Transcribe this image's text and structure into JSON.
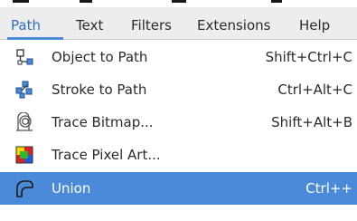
{
  "menubar": {
    "items": [
      {
        "label": "Path"
      },
      {
        "label": "Text"
      },
      {
        "label": "Filters"
      },
      {
        "label": "Extensions"
      },
      {
        "label": "Help"
      }
    ],
    "active": "Path"
  },
  "menu": {
    "items": [
      {
        "label": "Object to Path",
        "shortcut": "Shift+Ctrl+C",
        "icon": "object-to-path-icon"
      },
      {
        "label": "Stroke to Path",
        "shortcut": "Ctrl+Alt+C",
        "icon": "stroke-to-path-icon"
      },
      {
        "label": "Trace Bitmap...",
        "shortcut": "Shift+Alt+B",
        "icon": "trace-bitmap-icon"
      },
      {
        "label": "Trace Pixel Art...",
        "shortcut": "",
        "icon": "trace-pixel-art-icon"
      },
      {
        "label": "Union",
        "shortcut": "Ctrl++",
        "icon": "union-icon"
      }
    ],
    "highlighted": "Union"
  },
  "colors": {
    "menubar_bg": "#ededed",
    "active_menu_text": "#2d6fbf",
    "highlight": "#4a8ad8"
  }
}
